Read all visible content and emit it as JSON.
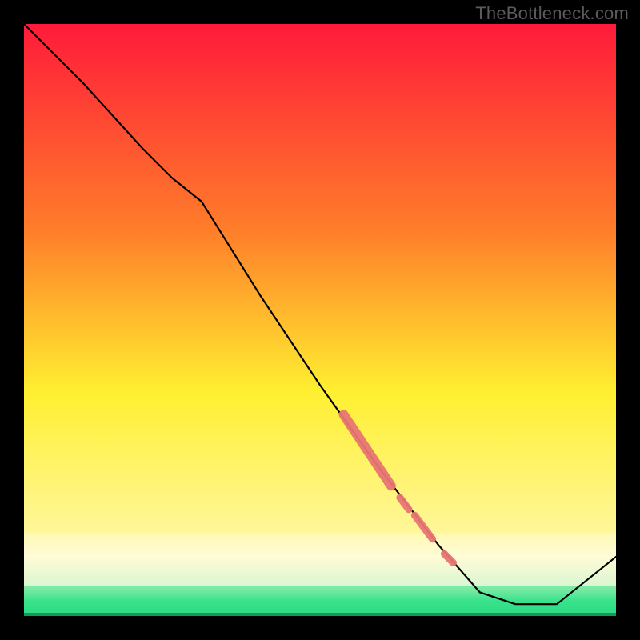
{
  "watermark": "TheBottleneck.com",
  "chart_data": {
    "type": "line",
    "title": "",
    "xlabel": "",
    "ylabel": "",
    "xlim": [
      0,
      100
    ],
    "ylim": [
      0,
      100
    ],
    "line": {
      "x": [
        0,
        10,
        20,
        25,
        30,
        40,
        50,
        60,
        70,
        77,
        83,
        90,
        100
      ],
      "y": [
        100,
        90,
        79,
        74,
        70,
        54,
        39,
        25,
        12,
        4,
        2,
        2,
        10
      ]
    },
    "highlight_segments": [
      {
        "x": [
          54,
          62
        ],
        "y": [
          34,
          22
        ],
        "thick": true
      },
      {
        "x": [
          63.5,
          65
        ],
        "y": [
          20,
          18
        ],
        "thick": false
      },
      {
        "x": [
          66,
          69
        ],
        "y": [
          17,
          13
        ],
        "thick": false
      },
      {
        "x": [
          71,
          72.5
        ],
        "y": [
          10.5,
          9
        ],
        "thick": false
      }
    ],
    "gradient": {
      "top_color": "#ff1a3a",
      "mid_color_1": "#ff7e2a",
      "mid_color_2": "#ffef30",
      "pale_color": "#fffbc8",
      "green_color": "#38e28a"
    },
    "green_band_y": [
      0,
      5
    ],
    "pale_band_y": [
      5,
      14
    ]
  }
}
